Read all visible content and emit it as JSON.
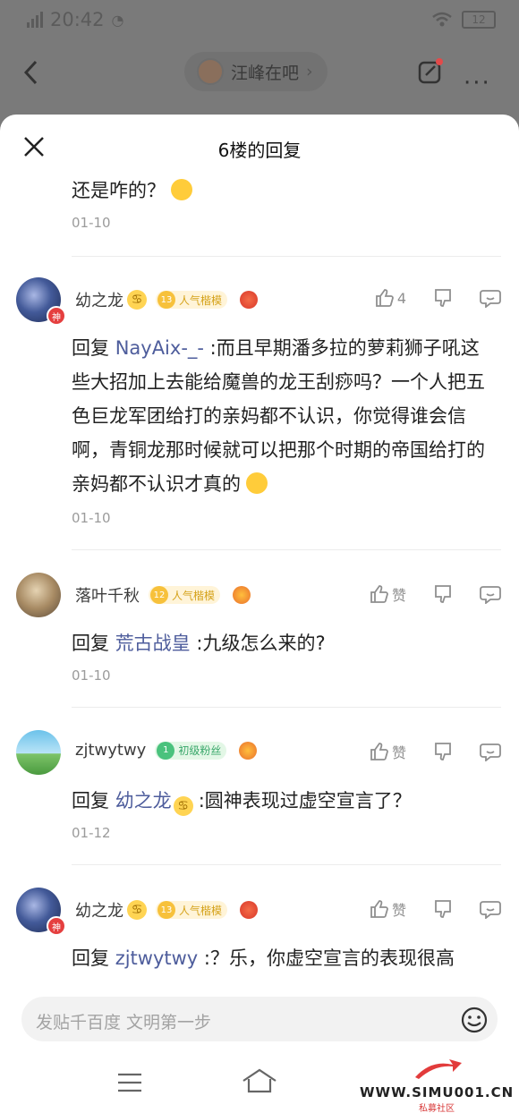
{
  "status_bar": {
    "time": "20:42",
    "battery": "12"
  },
  "nav": {
    "forum_name": "汪峰在吧"
  },
  "sheet": {
    "title": "6楼的回复"
  },
  "partial_top": {
    "text": "还是咋的？",
    "date": "01-10"
  },
  "replies": [
    {
      "username": "幼之龙",
      "has_zodiac": true,
      "level": "13",
      "level_title": "人气楷模",
      "badge": "神",
      "like_label": "4",
      "prefix": "回复",
      "mention": "NayAix-_-",
      "text": ":而且早期潘多拉的萝莉狮子吼这些大招加上去能给魔兽的龙王刮痧吗？一个人把五色巨龙军团给打的亲妈都不认识，你觉得谁会信啊，青铜龙那时候就可以把那个时期的帝国给打的亲妈都不认识才真的",
      "date": "01-10"
    },
    {
      "username": "落叶千秋",
      "level": "12",
      "level_title": "人气楷模",
      "like_label": "赞",
      "prefix": "回复",
      "mention": "荒古战皇",
      "text": ":九级怎么来的?",
      "date": "01-10"
    },
    {
      "username": "zjtwytwy",
      "level": "1",
      "level_title": "初级粉丝",
      "like_label": "赞",
      "prefix": "回复",
      "mention": "幼之龙",
      "text": ":圆神表现过虚空宣言了？",
      "date": "01-12"
    },
    {
      "username": "幼之龙",
      "level": "13",
      "level_title": "人气楷模",
      "badge": "神",
      "like_label": "赞",
      "prefix": "回复",
      "mention": "zjtwytwy",
      "text": ":？乐，你虚空宣言的表现很高"
    }
  ],
  "input": {
    "placeholder": "发贴千百度 文明第一步"
  },
  "watermark": {
    "text": "WWW.SIMU001.CN",
    "sub": "私募社区"
  },
  "colors": {
    "mention": "#4e5d9c",
    "level_gold": "#f7c13b",
    "level_green": "#4ac27d"
  }
}
